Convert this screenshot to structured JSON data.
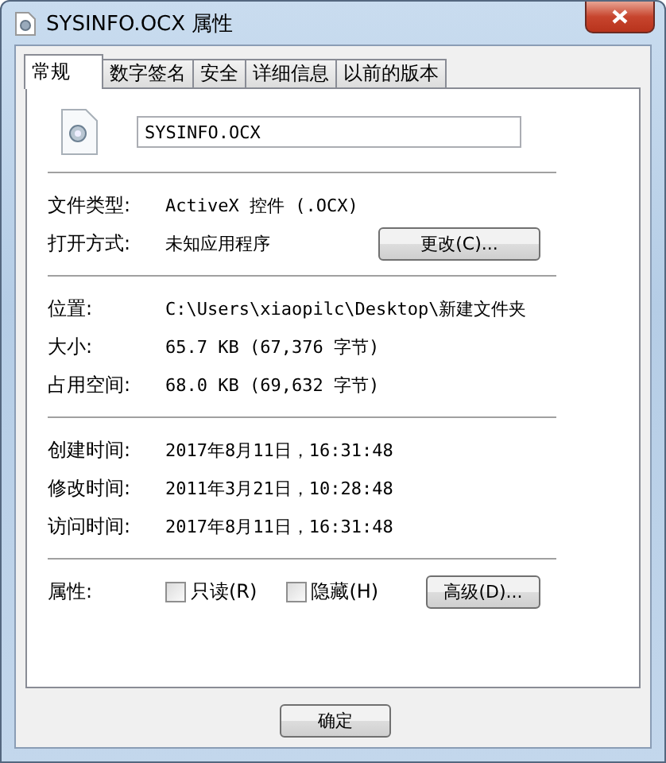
{
  "window": {
    "title": "SYSINFO.OCX 属性"
  },
  "tabs": [
    {
      "label": "常规",
      "selected": true
    },
    {
      "label": "数字签名",
      "selected": false
    },
    {
      "label": "安全",
      "selected": false
    },
    {
      "label": "详细信息",
      "selected": false
    },
    {
      "label": "以前的版本",
      "selected": false
    }
  ],
  "file_name": "SYSINFO.OCX",
  "sections": [
    [
      {
        "label": "文件类型:",
        "value": "ActiveX 控件 (.OCX)"
      },
      {
        "label": "打开方式:",
        "value": "未知应用程序",
        "button": "更改(C)..."
      }
    ],
    [
      {
        "label": "位置:",
        "value": "C:\\Users\\xiaopilc\\Desktop\\新建文件夹"
      },
      {
        "label": "大小:",
        "value": "65.7 KB (67,376 字节)"
      },
      {
        "label": "占用空间:",
        "value": "68.0 KB (69,632 字节)"
      }
    ],
    [
      {
        "label": "创建时间:",
        "value": "2017年8月11日，16:31:48"
      },
      {
        "label": "修改时间:",
        "value": "2011年3月21日，10:28:48"
      },
      {
        "label": "访问时间:",
        "value": "2017年8月11日，16:31:48"
      }
    ]
  ],
  "attributes": {
    "label": "属性:",
    "checkboxes": [
      {
        "label": "只读(R)",
        "checked": false
      },
      {
        "label": "隐藏(H)",
        "checked": false
      }
    ],
    "button": "高级(D)..."
  },
  "buttons": [
    "确定"
  ]
}
